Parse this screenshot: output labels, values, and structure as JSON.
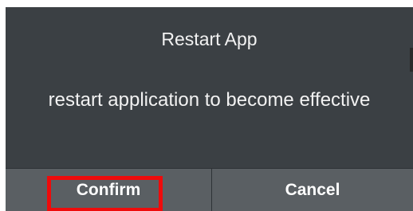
{
  "dialog": {
    "title": "Restart App",
    "message": "restart application to become effective",
    "buttons": {
      "confirm_label": "Confirm",
      "cancel_label": "Cancel"
    }
  },
  "colors": {
    "dialog_background": "#3b4044",
    "button_bar_background": "#5a5f63",
    "highlight_outline": "#ee0b0b",
    "text": "#f2f2f2"
  },
  "annotation": {
    "highlighted_button": "confirm"
  }
}
